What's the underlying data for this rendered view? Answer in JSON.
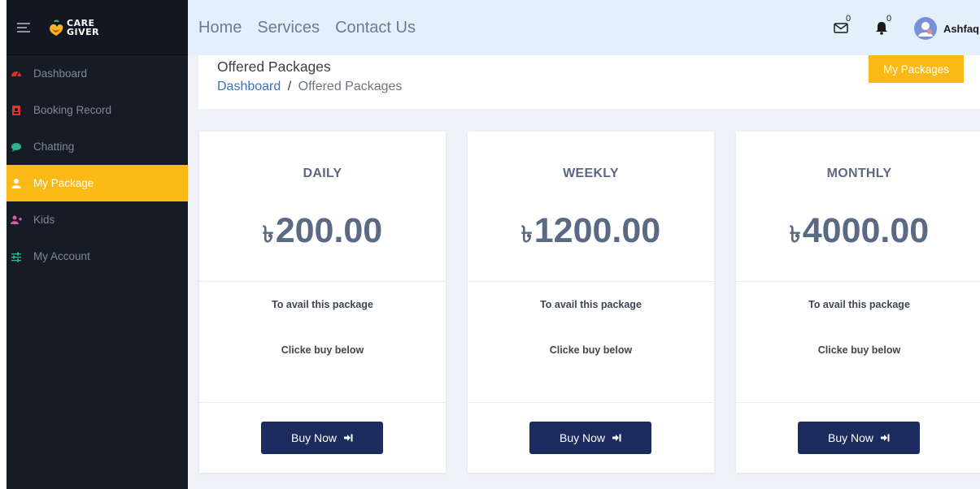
{
  "brand": {
    "line1": "CARE",
    "line2": "GIVER"
  },
  "sidebar": {
    "items": [
      {
        "label": "Dashboard",
        "icon": "tachometer-icon",
        "color": "#e0342b"
      },
      {
        "label": "Booking Record",
        "icon": "address-book-icon",
        "color": "#e0342b"
      },
      {
        "label": "Chatting",
        "icon": "comment-icon",
        "color": "#2fb38a"
      },
      {
        "label": "My Package",
        "icon": "user-icon",
        "color": "#ffffff",
        "active": true
      },
      {
        "label": "Kids",
        "icon": "user-plus-icon",
        "color": "#e05aa8"
      },
      {
        "label": "My Account",
        "icon": "sliders-icon",
        "color": "#2fb38a"
      }
    ]
  },
  "topbar": {
    "links": [
      "Home",
      "Services",
      "Contact Us"
    ],
    "mail_count": "0",
    "notification_count": "0",
    "username": "Ashfaq"
  },
  "page": {
    "title": "Offered Packages",
    "breadcrumb_root": "Dashboard",
    "breadcrumb_separator": "/",
    "breadcrumb_current": "Offered Packages",
    "my_packages_button": "My Packages"
  },
  "packages": [
    {
      "name": "DAILY",
      "currency": "৳",
      "price": "200.00",
      "line1": "To avail this package",
      "line2": "Clicke buy below",
      "button": "Buy Now"
    },
    {
      "name": "WEEKLY",
      "currency": "৳",
      "price": "1200.00",
      "line1": "To avail this package",
      "line2": "Clicke buy below",
      "button": "Buy Now"
    },
    {
      "name": "MONTHLY",
      "currency": "৳",
      "price": "4000.00",
      "line1": "To avail this package",
      "line2": "Clicke buy below",
      "button": "Buy Now"
    }
  ],
  "colors": {
    "accent": "#fbb917",
    "sidebar_bg": "#161c26",
    "topbar_bg": "#e3f0fb",
    "button_navy": "#1c2b5e",
    "card_text": "#5a6a83"
  }
}
